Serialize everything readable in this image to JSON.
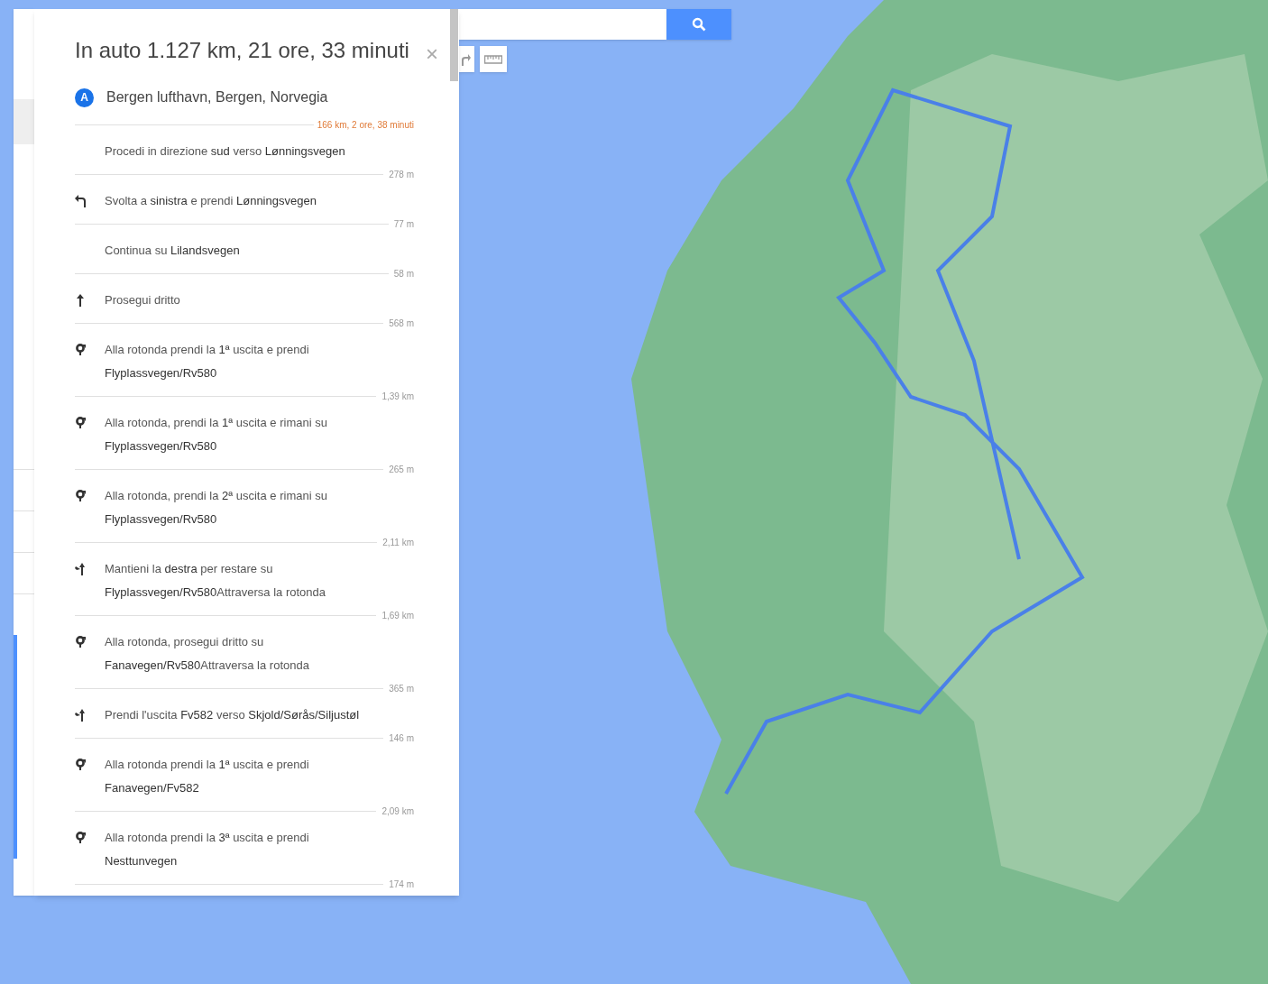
{
  "directions": {
    "title": "In auto 1.127 km, 21 ore, 33 minuti",
    "close": "×",
    "start": {
      "marker": "A",
      "place": "Bergen lufthavn, Bergen, Norvegia"
    },
    "summary": "166 km, 2 ore, 38 minuti",
    "steps": [
      {
        "kind": "none",
        "lines": [
          "Procedi in direzione **sud** verso **Lønningsvegen**"
        ],
        "distance": "278 m"
      },
      {
        "kind": "turn-left",
        "lines": [
          "Svolta a **sinistra** e prendi **Lønningsvegen**"
        ],
        "distance": "77 m"
      },
      {
        "kind": "none",
        "lines": [
          "Continua su **Lilandsvegen**"
        ],
        "distance": "58 m"
      },
      {
        "kind": "straight",
        "lines": [
          "Prosegui dritto"
        ],
        "distance": "568 m"
      },
      {
        "kind": "roundabout",
        "lines": [
          "Alla rotonda prendi la **1ª** uscita e prendi",
          "**Flyplassvegen/Rv580**"
        ],
        "distance": "1,39 km"
      },
      {
        "kind": "roundabout",
        "lines": [
          "Alla rotonda, prendi la **1ª** uscita e rimani su",
          "**Flyplassvegen/Rv580**"
        ],
        "distance": "265 m"
      },
      {
        "kind": "roundabout",
        "lines": [
          "Alla rotonda, prendi la **2ª** uscita e rimani su",
          "**Flyplassvegen/Rv580**"
        ],
        "distance": "2,11 km"
      },
      {
        "kind": "keep",
        "lines": [
          "Mantieni la **destra** per restare su",
          "**Flyplassvegen/Rv580**Attraversa la rotonda"
        ],
        "distance": "1,69 km"
      },
      {
        "kind": "roundabout",
        "lines": [
          "Alla rotonda, prosegui dritto su",
          "**Fanavegen/Rv580**Attraversa la rotonda"
        ],
        "distance": "365 m"
      },
      {
        "kind": "keep",
        "lines": [
          "Prendi l'uscita **Fv582** verso **Skjold/Sørås/Siljustøl**"
        ],
        "distance": "146 m"
      },
      {
        "kind": "roundabout",
        "lines": [
          "Alla rotonda prendi la **1ª** uscita e prendi",
          "**Fanavegen/Fv582**"
        ],
        "distance": "2,09 km"
      },
      {
        "kind": "roundabout",
        "lines": [
          "Alla rotonda prendi la **3ª** uscita e prendi",
          "**Nesttunvegen**"
        ],
        "distance": "174 m"
      }
    ]
  }
}
